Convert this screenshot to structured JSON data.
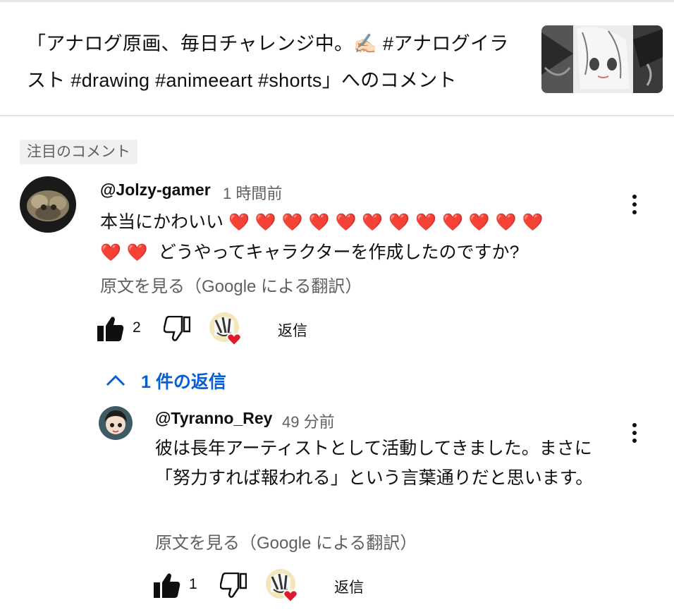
{
  "header": {
    "title": "「アナログ原画、毎日チャレンジ中。✍🏻 #アナログイラスト #drawing #animeeart #shorts」へのコメント"
  },
  "pinned_label": "注目のコメント",
  "comments": [
    {
      "author": "@Jolzy-gamer",
      "time": "1 時間前",
      "text_before": "本当にかわいい",
      "hearts": "❤️❤️❤️❤️❤️❤️❤️❤️❤️❤️❤️❤️",
      "hearts2": "❤️❤️",
      "text_after": "どうやってキャラクターを作成したのですか?",
      "translate": "原文を見る（Google による翻訳）",
      "likes": "2",
      "reply_label": "返信"
    }
  ],
  "replies_toggle": "1 件の返信",
  "reply": {
    "author": "@Tyranno_Rey",
    "time": "49 分前",
    "text": "彼は長年アーティストとして活動してきました。まさに「努力すれば報われる」という言葉通りだと思います。",
    "translate": "原文を見る（Google による翻訳）",
    "likes": "1",
    "reply_label": "返信"
  },
  "icons": {
    "like": "thumbs-up-icon",
    "dislike": "thumbs-down-icon",
    "creator_heart": "creator-heart-avatar",
    "more": "more-vertical-icon",
    "chevron": "chevron-up-icon"
  },
  "colors": {
    "link_blue": "#065fd4",
    "heart_red": "#e1192e",
    "secondary_text": "#606060"
  }
}
